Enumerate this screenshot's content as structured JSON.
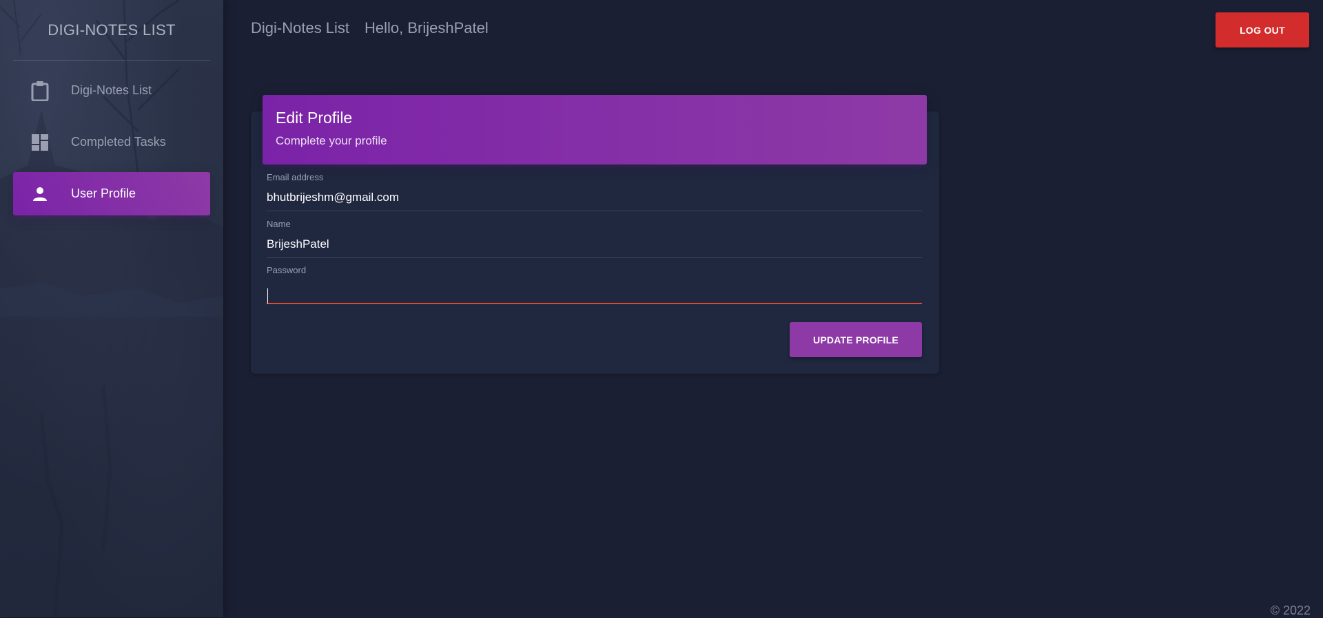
{
  "sidebar": {
    "logo": "DIGI-NOTES LIST",
    "items": [
      {
        "label": "Digi-Notes List",
        "icon": "clipboard-icon",
        "active": false
      },
      {
        "label": "Completed Tasks",
        "icon": "dashboard-icon",
        "active": false
      },
      {
        "label": "User Profile",
        "icon": "person-icon",
        "active": true
      }
    ]
  },
  "header": {
    "brand": "Digi-Notes List",
    "greeting": "Hello, BrijeshPatel",
    "logout_label": "LOG OUT"
  },
  "profile_card": {
    "title": "Edit Profile",
    "subtitle": "Complete your profile",
    "fields": {
      "email": {
        "label": "Email address",
        "value": "bhutbrijeshm@gmail.com"
      },
      "name": {
        "label": "Name",
        "value": "BrijeshPatel"
      },
      "password": {
        "label": "Password",
        "value": ""
      }
    },
    "update_label": "UPDATE PROFILE"
  },
  "footer": {
    "copyright": "© 2022"
  },
  "colors": {
    "accent_purple": "#8e3aa6",
    "danger_red": "#d32c2c",
    "background": "#1b1f33",
    "card": "#202840",
    "focus_underline": "#e0492f"
  }
}
